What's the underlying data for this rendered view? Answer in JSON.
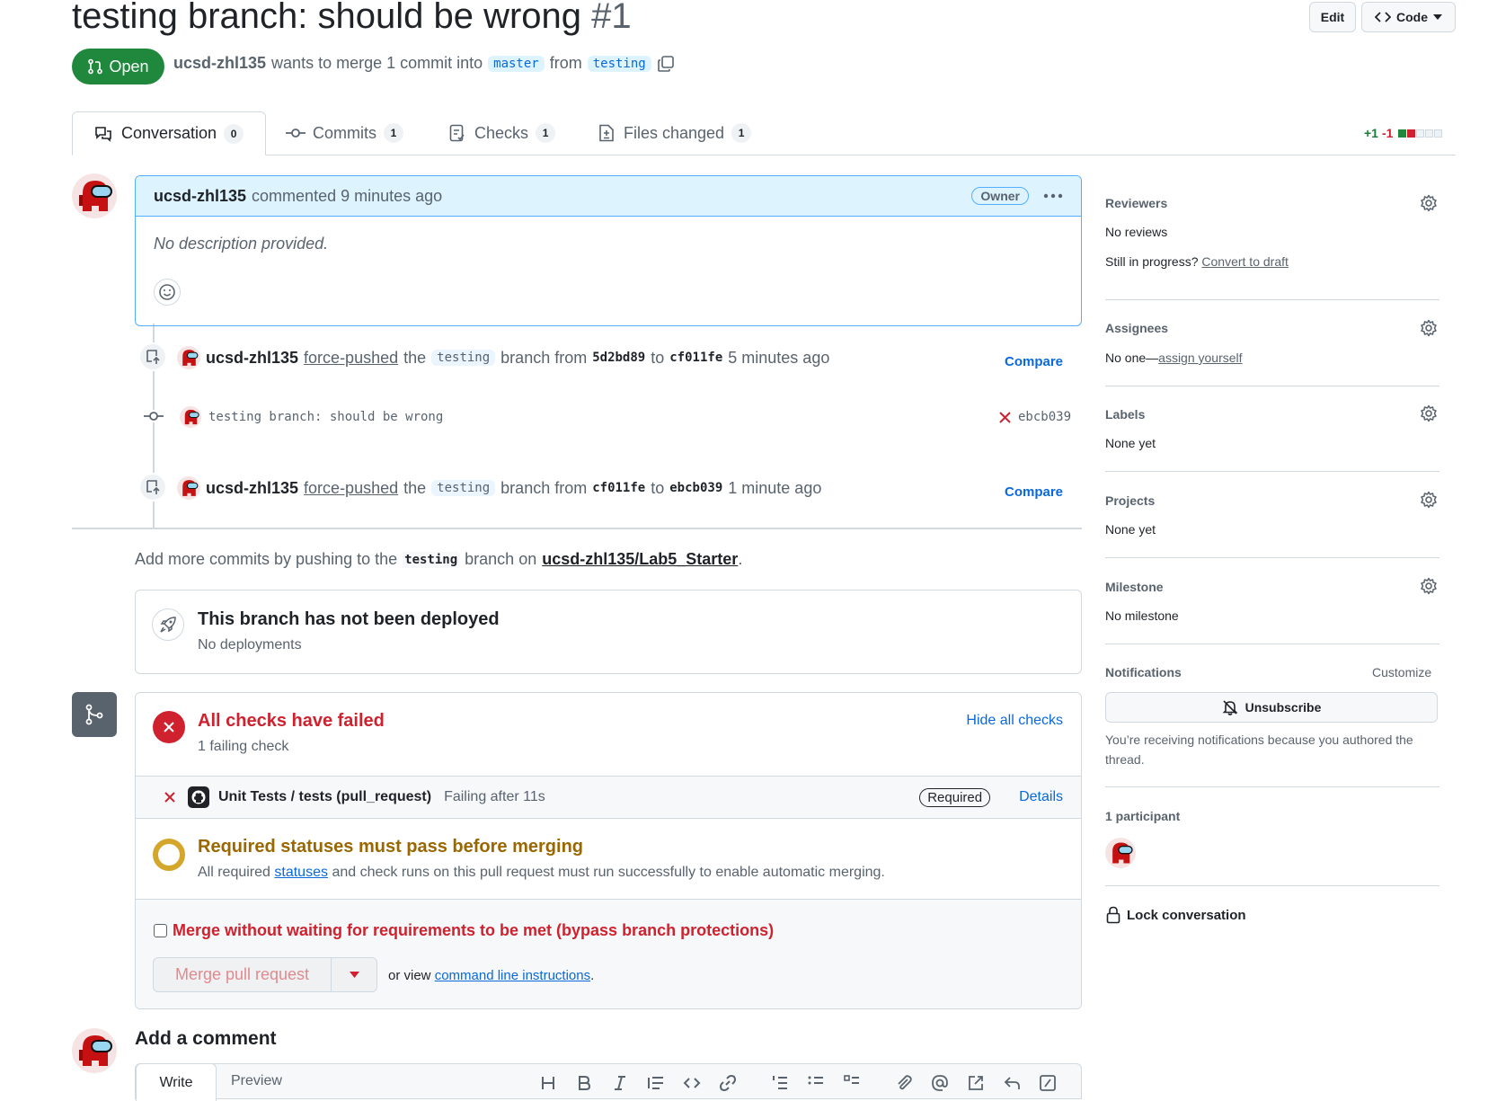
{
  "header": {
    "title": "testing branch: should be wrong",
    "number": "#1",
    "edit_label": "Edit",
    "code_label": "Code",
    "state_label": "Open",
    "author": "ucsd-zhl135",
    "merge_text": "wants to merge 1 commit into",
    "base_branch": "master",
    "from_text": "from",
    "head_branch": "testing"
  },
  "tabs": [
    {
      "label": "Conversation",
      "count": "0"
    },
    {
      "label": "Commits",
      "count": "1"
    },
    {
      "label": "Checks",
      "count": "1"
    },
    {
      "label": "Files changed",
      "count": "1"
    }
  ],
  "diffstat": {
    "added": "+1",
    "removed": "-1"
  },
  "comment": {
    "author": "ucsd-zhl135",
    "action": "commented 9 minutes ago",
    "role": "Owner",
    "body": "No description provided."
  },
  "timeline": [
    {
      "author": "ucsd-zhl135",
      "action": "force-pushed",
      "the": "the",
      "branch": "testing",
      "from_text": "branch from",
      "from_sha": "5d2bd89",
      "to_text": "to",
      "to_sha": "cf011fe",
      "time": "5 minutes ago",
      "compare": "Compare"
    },
    {
      "commit_message": "testing branch: should be wrong",
      "sha": "ebcb039"
    },
    {
      "author": "ucsd-zhl135",
      "action": "force-pushed",
      "the": "the",
      "branch": "testing",
      "from_text": "branch from",
      "from_sha": "cf011fe",
      "to_text": "to",
      "to_sha": "ebcb039",
      "time": "1 minute ago",
      "compare": "Compare"
    }
  ],
  "push_hint": {
    "prefix": "Add more commits by pushing to the",
    "branch": "testing",
    "middle": "branch on",
    "repo": "ucsd-zhl135/Lab5_Starter",
    "suffix": "."
  },
  "deploy": {
    "title": "This branch has not been deployed",
    "subtitle": "No deployments"
  },
  "checks": {
    "title": "All checks have failed",
    "subtitle": "1 failing check",
    "hide_label": "Hide all checks",
    "item_name": "Unit Tests / tests (pull_request)",
    "item_status": "Failing after 11s",
    "item_required": "Required",
    "item_details": "Details",
    "required_title": "Required statuses must pass before merging",
    "required_prefix": "All required",
    "required_link": "statuses",
    "required_suffix": "and check runs on this pull request must run successfully to enable automatic merging.",
    "bypass_label": "Merge without waiting for requirements to be met (bypass branch protections)",
    "merge_label": "Merge pull request",
    "or_view": "or view",
    "cli_link": "command line instructions",
    "period": "."
  },
  "add_comment": {
    "title": "Add a comment",
    "write_tab": "Write",
    "preview_tab": "Preview"
  },
  "sidebar": {
    "reviewers_title": "Reviewers",
    "reviewers_value": "No reviews",
    "still_progress": "Still in progress?",
    "convert_draft": "Convert to draft",
    "assignees_title": "Assignees",
    "assignees_value": "No one—",
    "assign_yourself": "assign yourself",
    "labels_title": "Labels",
    "labels_value": "None yet",
    "projects_title": "Projects",
    "projects_value": "None yet",
    "milestone_title": "Milestone",
    "milestone_value": "No milestone",
    "notifications_title": "Notifications",
    "customize": "Customize",
    "unsubscribe": "Unsubscribe",
    "notify_reason": "You’re receiving notifications because you authored the thread.",
    "participants_title": "1 participant",
    "lock_label": "Lock conversation"
  },
  "colors": {
    "accent": "#0969da",
    "open_green": "#1f883d",
    "danger": "#cf222e",
    "attention": "#bf8700"
  }
}
